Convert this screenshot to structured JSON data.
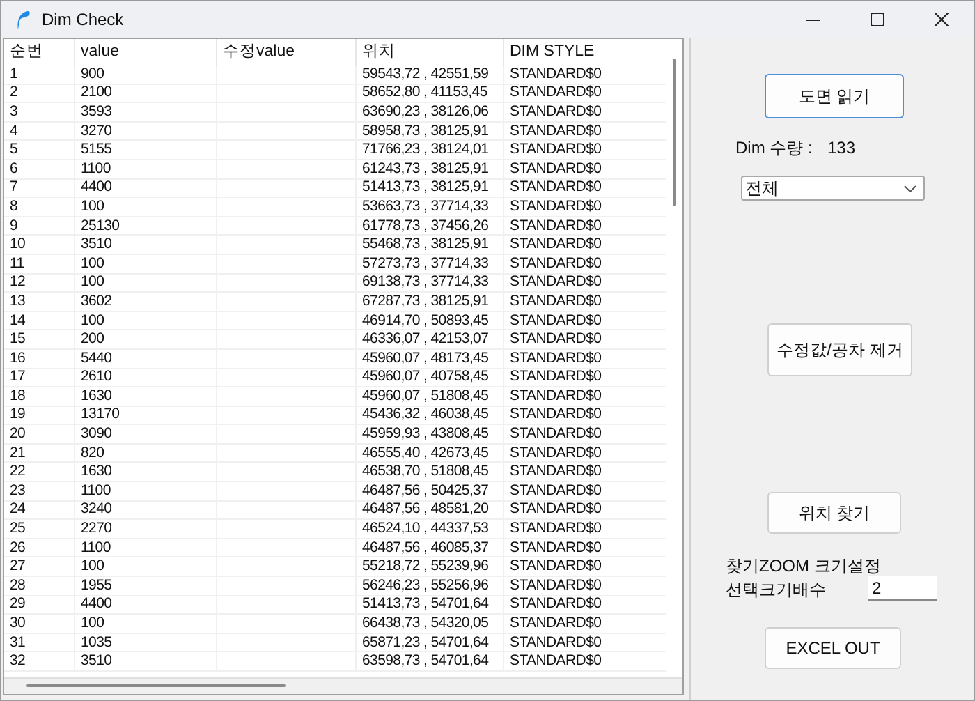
{
  "window": {
    "title": "Dim Check"
  },
  "table": {
    "columns": [
      "순번",
      "value",
      "수정value",
      "위치",
      "DIM STYLE"
    ],
    "rows": [
      [
        "1",
        "900",
        "",
        "59543,72 , 42551,59",
        "STANDARD$0"
      ],
      [
        "2",
        "2100",
        "",
        "58652,80 , 41153,45",
        "STANDARD$0"
      ],
      [
        "3",
        "3593",
        "",
        "63690,23 , 38126,06",
        "STANDARD$0"
      ],
      [
        "4",
        "3270",
        "",
        "58958,73 , 38125,91",
        "STANDARD$0"
      ],
      [
        "5",
        "5155",
        "",
        "71766,23 , 38124,01",
        "STANDARD$0"
      ],
      [
        "6",
        "1100",
        "",
        "61243,73 , 38125,91",
        "STANDARD$0"
      ],
      [
        "7",
        "4400",
        "",
        "51413,73 , 38125,91",
        "STANDARD$0"
      ],
      [
        "8",
        "100",
        "",
        "53663,73 , 37714,33",
        "STANDARD$0"
      ],
      [
        "9",
        "25130",
        "",
        "61778,73 , 37456,26",
        "STANDARD$0"
      ],
      [
        "10",
        "3510",
        "",
        "55468,73 , 38125,91",
        "STANDARD$0"
      ],
      [
        "11",
        "100",
        "",
        "57273,73 , 37714,33",
        "STANDARD$0"
      ],
      [
        "12",
        "100",
        "",
        "69138,73 , 37714,33",
        "STANDARD$0"
      ],
      [
        "13",
        "3602",
        "",
        "67287,73 , 38125,91",
        "STANDARD$0"
      ],
      [
        "14",
        "100",
        "",
        "46914,70 , 50893,45",
        "STANDARD$0"
      ],
      [
        "15",
        "200",
        "",
        "46336,07 , 42153,07",
        "STANDARD$0"
      ],
      [
        "16",
        "5440",
        "",
        "45960,07 , 48173,45",
        "STANDARD$0"
      ],
      [
        "17",
        "2610",
        "",
        "45960,07 , 40758,45",
        "STANDARD$0"
      ],
      [
        "18",
        "1630",
        "",
        "45960,07 , 51808,45",
        "STANDARD$0"
      ],
      [
        "19",
        "13170",
        "",
        "45436,32 , 46038,45",
        "STANDARD$0"
      ],
      [
        "20",
        "3090",
        "",
        "45959,93 , 43808,45",
        "STANDARD$0"
      ],
      [
        "21",
        "820",
        "",
        "46555,40 , 42673,45",
        "STANDARD$0"
      ],
      [
        "22",
        "1630",
        "",
        "46538,70 , 51808,45",
        "STANDARD$0"
      ],
      [
        "23",
        "1100",
        "",
        "46487,56 , 50425,37",
        "STANDARD$0"
      ],
      [
        "24",
        "3240",
        "",
        "46487,56 , 48581,20",
        "STANDARD$0"
      ],
      [
        "25",
        "2270",
        "",
        "46524,10 , 44337,53",
        "STANDARD$0"
      ],
      [
        "26",
        "1100",
        "",
        "46487,56 , 46085,37",
        "STANDARD$0"
      ],
      [
        "27",
        "100",
        "",
        "55218,72 , 55239,96",
        "STANDARD$0"
      ],
      [
        "28",
        "1955",
        "",
        "56246,23 , 55256,96",
        "STANDARD$0"
      ],
      [
        "29",
        "4400",
        "",
        "51413,73 , 54701,64",
        "STANDARD$0"
      ],
      [
        "30",
        "100",
        "",
        "66438,73 , 54320,05",
        "STANDARD$0"
      ],
      [
        "31",
        "1035",
        "",
        "65871,23 , 54701,64",
        "STANDARD$0"
      ],
      [
        "32",
        "3510",
        "",
        "63598,73 , 54701,64",
        "STANDARD$0"
      ]
    ]
  },
  "panel": {
    "read_button": "도면 읽기",
    "count_label": "Dim 수량 :",
    "count_value": "133",
    "filter": {
      "value": "전체"
    },
    "remove_button": "수정값/공차 제거",
    "find_button": "위치 찾기",
    "zoom_label_1": "찾기ZOOM 크기설정",
    "zoom_label_2": "선택크기배수",
    "zoom_field": {
      "value": "2"
    },
    "excel_button": "EXCEL OUT"
  }
}
